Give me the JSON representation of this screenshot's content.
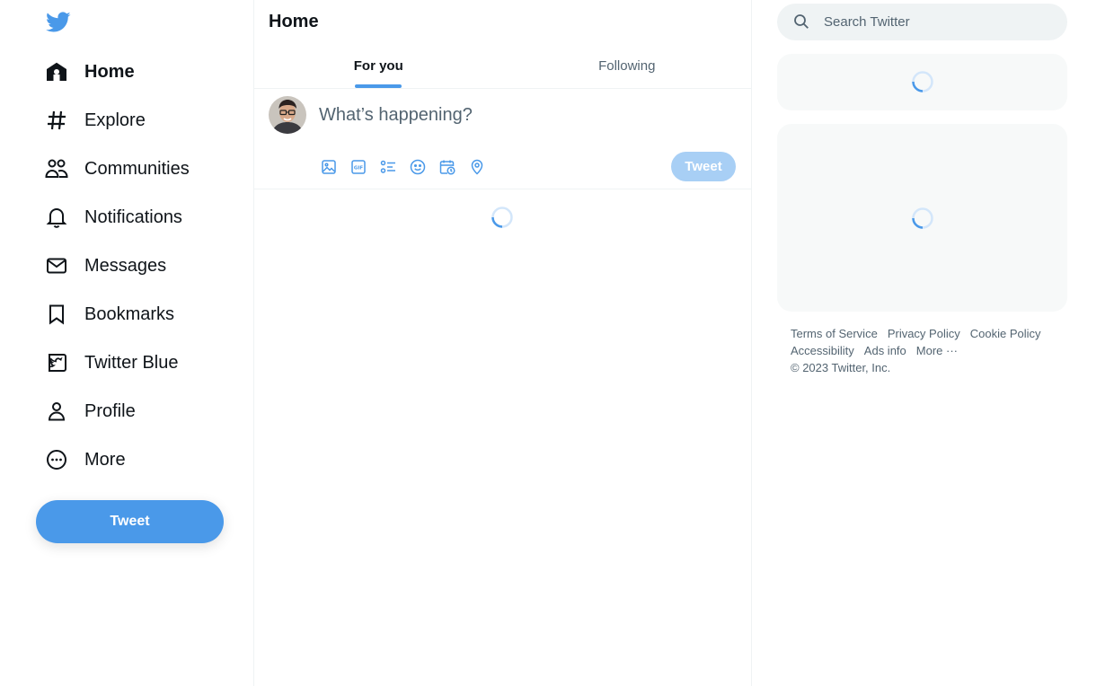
{
  "sidebar": {
    "nav": [
      {
        "label": "Home",
        "icon": "home-icon"
      },
      {
        "label": "Explore",
        "icon": "hashtag-icon"
      },
      {
        "label": "Communities",
        "icon": "communities-icon"
      },
      {
        "label": "Notifications",
        "icon": "bell-icon"
      },
      {
        "label": "Messages",
        "icon": "envelope-icon"
      },
      {
        "label": "Bookmarks",
        "icon": "bookmark-icon"
      },
      {
        "label": "Twitter Blue",
        "icon": "twitter-blue-icon"
      },
      {
        "label": "Profile",
        "icon": "person-icon"
      },
      {
        "label": "More",
        "icon": "more-circle-icon"
      }
    ],
    "tweet_button": "Tweet"
  },
  "main": {
    "title": "Home",
    "tabs": [
      {
        "label": "For you",
        "active": true
      },
      {
        "label": "Following",
        "active": false
      }
    ],
    "compose": {
      "placeholder": "What’s happening?",
      "tweet_button": "Tweet",
      "tools": [
        "image-icon",
        "gif-icon",
        "poll-icon",
        "emoji-icon",
        "schedule-icon",
        "location-icon"
      ]
    }
  },
  "right": {
    "search_placeholder": "Search Twitter",
    "footer": {
      "row1": [
        "Terms of Service",
        "Privacy Policy",
        "Cookie Policy"
      ],
      "row2": [
        "Accessibility",
        "Ads info",
        "More ···"
      ],
      "copyright": "© 2023 Twitter, Inc."
    }
  },
  "colors": {
    "accent": "#4a99e9",
    "accent_disabled": "#a8cff5",
    "text": "#0f1419",
    "muted": "#536471",
    "panel": "#f7f9f9"
  }
}
